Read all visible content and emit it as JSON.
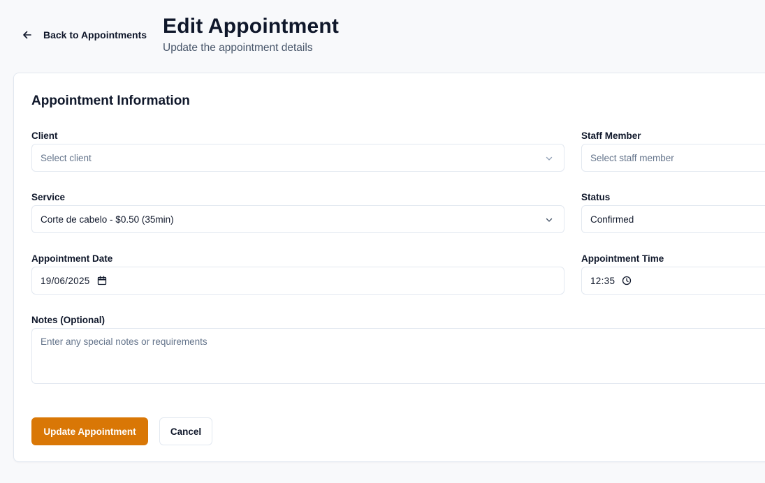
{
  "header": {
    "back_label": "Back to Appointments",
    "title": "Edit Appointment",
    "subtitle": "Update the appointment details"
  },
  "form": {
    "section_title": "Appointment Information",
    "client": {
      "label": "Client",
      "placeholder": "Select client",
      "value": ""
    },
    "staff": {
      "label": "Staff Member",
      "placeholder": "Select staff member",
      "value": ""
    },
    "service": {
      "label": "Service",
      "value": "Corte de cabelo - $0.50 (35min)"
    },
    "status": {
      "label": "Status",
      "value": "Confirmed"
    },
    "date": {
      "label": "Appointment Date",
      "value": "19/06/2025"
    },
    "time": {
      "label": "Appointment Time",
      "value": "12:35"
    },
    "notes": {
      "label": "Notes (Optional)",
      "placeholder": "Enter any special notes or requirements"
    }
  },
  "actions": {
    "submit_label": "Update Appointment",
    "cancel_label": "Cancel"
  },
  "colors": {
    "accent": "#d97706",
    "background": "#f8f9fb",
    "border": "#e2e8f0"
  },
  "icons": {
    "back": "arrow-left-icon",
    "select": "chevron-down-icon",
    "date": "calendar-icon",
    "time": "clock-icon"
  }
}
